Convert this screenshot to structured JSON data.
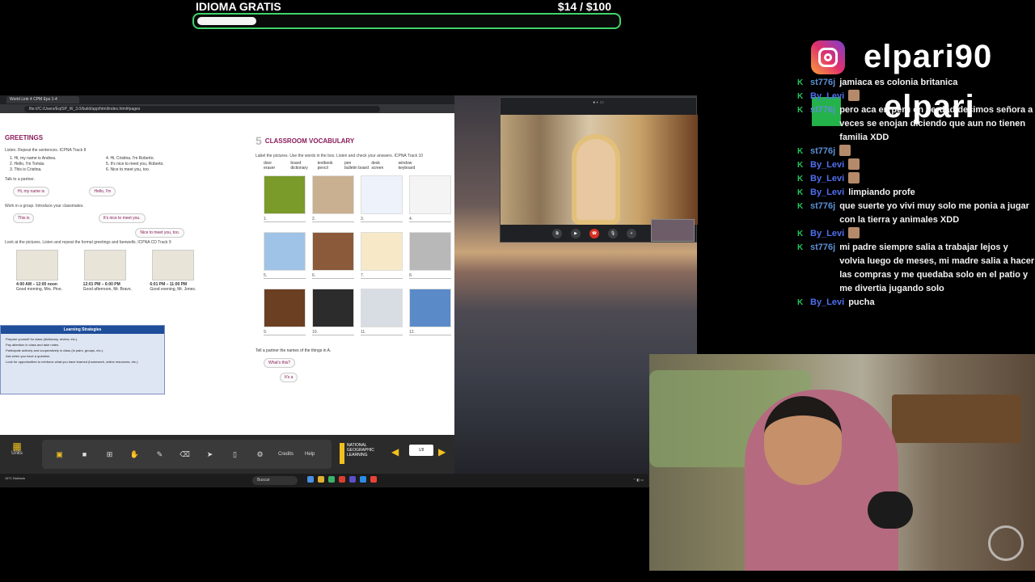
{
  "goal": {
    "title": "IDIOMA GRATIS",
    "amount": "$14  /  $100",
    "progress_percent": 14
  },
  "social": {
    "platform_icon": "instagram-icon",
    "handle": "elpari90",
    "handle_ghost": "elpari"
  },
  "chat": [
    {
      "user": "st776j",
      "text": "jamiaca es colonia britanica"
    },
    {
      "user": "By_Levi",
      "text": ""
    },
    {
      "user": "st776j",
      "text": "pero aca en peru en verdad decimos señora a veces se enojan diciendo que aun no tienen familia XDD"
    },
    {
      "user": "st776j",
      "text": ""
    },
    {
      "user": "By_Levi",
      "text": ""
    },
    {
      "user": "By_Levi",
      "text": ""
    },
    {
      "user": "By_Levi",
      "text": "limpiando profe"
    },
    {
      "user": "st776j",
      "text": "que suerte yo vivi muy solo me ponia a jugar con la tierra y animales XDD"
    },
    {
      "user": "By_Levi",
      "text": ""
    },
    {
      "user": "st776j",
      "text": "mi padre siempre salia a trabajar lejos y volvia luego de meses, mi madre salia a hacer las compras y me quedaba solo en el patio y me divertia jugando solo"
    },
    {
      "user": "By_Levi",
      "text": "pucha"
    }
  ],
  "browser": {
    "tab": "World Link 4 CPM Eps 1-4",
    "url": "file:///C:/Users/Eq/SP_W_3.0/build/app/html/index.html#pages"
  },
  "lesson": {
    "greetings": {
      "title": "GREETINGS",
      "instruction1": "Listen. Repeat the sentences. ICPNA Track 8",
      "sentences": [
        "1. Hi, my name is Andrea.",
        "4. Hi, Cristina. I'm Roberto.",
        "2. Hello, I'm Tomás.",
        "5. It's nice to meet you, Roberto.",
        "3. This is Cristina.",
        "6. Nice to meet you, too."
      ],
      "instruction2": "Talk to a partner.",
      "bubble1": "Hi, my name is",
      "bubble2": "Hello, I'm",
      "instruction3": "Work in a group. Introduce your classmates.",
      "bubble3": "This is",
      "bubble4": "It's nice to meet you.",
      "bubble5": "Nice to meet you, too.",
      "instruction4": "Look at the pictures. Listen and repeat the formal greetings and farewells. ICPNA CD Track 9",
      "times": [
        {
          "time": "4:00 AM – 12:00 noon",
          "text": "Good morning, Mrs. Pino."
        },
        {
          "time": "12:01 PM – 6:00 PM",
          "text": "Good afternoon, Mr. Bravo."
        },
        {
          "time": "6:01 PM – 11:00 PM",
          "text": "Good evening, Mr. Jones."
        }
      ]
    },
    "strategies": {
      "title": "Learning Strategies",
      "items": [
        "Prepare yourself for class (dictionary, review, etc.).",
        "Pay attention in class and take notes.",
        "Participate actively and cooperatively in class (in pairs, groups, etc.).",
        "Ask when you have a question.",
        "Look for opportunities to reinforce what you have learned (homework, online resources, etc.)."
      ]
    },
    "vocab": {
      "number": "5",
      "title": "CLASSROOM VOCABULARY",
      "instruction": "Label the pictures. Use the words in the box. Listen and check your answers. ICPNA Track 10",
      "words": [
        "door",
        "board",
        "textbook",
        "pen",
        "desk",
        "window",
        "eraser",
        "dictionary",
        "pencil",
        "bulletin board",
        "screen",
        "keyboard"
      ],
      "numbers": [
        "1.",
        "2.",
        "3.",
        "4.",
        "5.",
        "6.",
        "7.",
        "8.",
        "9.",
        "10.",
        "11.",
        "12."
      ],
      "partner": "Tell a partner the names of the things in A.",
      "q": "What's this?",
      "a": "It's a"
    }
  },
  "toolbar": {
    "units_label": "Units",
    "credits": "Credits",
    "help": "Help",
    "logo": "NATIONAL GEOGRAPHIC LEARNING",
    "page": "1/8"
  },
  "taskbar": {
    "weather": "16°C Nublado",
    "search": "Buscar"
  },
  "colors": {
    "goal_border": "#3fd46b",
    "badge": "#22c55e",
    "username_blue": "#4f6ff0",
    "heading_magenta": "#8a1b5a"
  }
}
